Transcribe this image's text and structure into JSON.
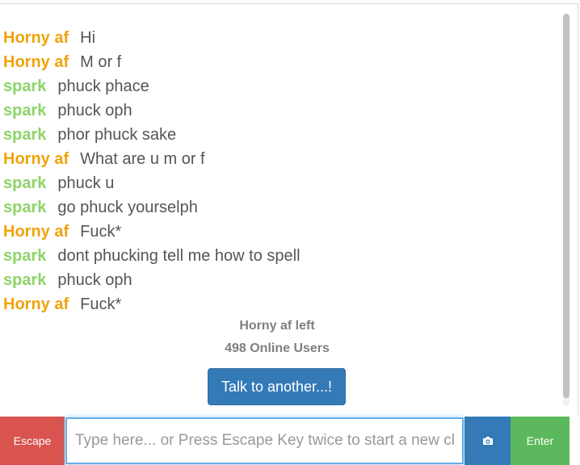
{
  "colors": {
    "stranger": "#f0a30a",
    "you": "#8ed469",
    "message_text": "#555555"
  },
  "messages": [
    {
      "sender": "Horny af",
      "role": "stranger",
      "text": "Hi"
    },
    {
      "sender": "Horny af",
      "role": "stranger",
      "text": "M or f"
    },
    {
      "sender": "spark",
      "role": "you",
      "text": "phuck phace"
    },
    {
      "sender": "spark",
      "role": "you",
      "text": "phuck oph"
    },
    {
      "sender": "spark",
      "role": "you",
      "text": "phor phuck sake"
    },
    {
      "sender": "Horny af",
      "role": "stranger",
      "text": "What are u m or f"
    },
    {
      "sender": "spark",
      "role": "you",
      "text": "phuck u"
    },
    {
      "sender": "spark",
      "role": "you",
      "text": "go phuck yourselph"
    },
    {
      "sender": "Horny af",
      "role": "stranger",
      "text": "Fuck*"
    },
    {
      "sender": "spark",
      "role": "you",
      "text": "dont phucking tell me how to spell"
    },
    {
      "sender": "spark",
      "role": "you",
      "text": "phuck oph"
    },
    {
      "sender": "Horny af",
      "role": "stranger",
      "text": "Fuck*"
    }
  ],
  "status": {
    "left_text": "Horny af left",
    "online_text": "498 Online Users"
  },
  "talk_button_label": "Talk to another...!",
  "input_bar": {
    "escape_label": "Escape",
    "placeholder": "Type here... or Press Escape Key twice to start a new chat",
    "value": "",
    "camera_icon": "camera-icon",
    "enter_label": "Enter"
  }
}
